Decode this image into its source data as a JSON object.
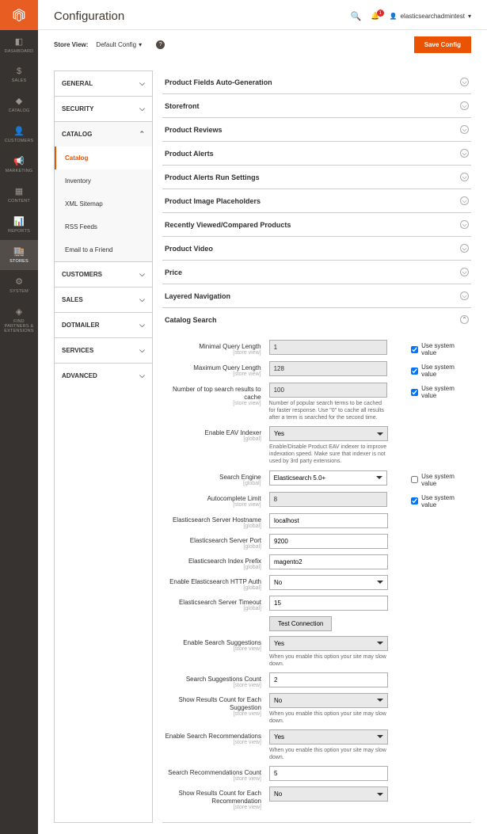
{
  "header": {
    "page_title": "Configuration",
    "notification_count": "1",
    "admin_user": "elasticsearchadmintest"
  },
  "toolbar": {
    "store_view_label": "Store View:",
    "store_view_value": "Default Config",
    "save_label": "Save Config"
  },
  "sidebar": {
    "dashboard": "DASHBOARD",
    "sales": "SALES",
    "catalog": "CATALOG",
    "customers": "CUSTOMERS",
    "marketing": "MARKETING",
    "content": "CONTENT",
    "reports": "REPORTS",
    "stores": "STORES",
    "system": "SYSTEM",
    "extensions": "FIND PARTNERS & EXTENSIONS"
  },
  "config_nav": {
    "groups": [
      {
        "label": "GENERAL",
        "expanded": false
      },
      {
        "label": "SECURITY",
        "expanded": false
      },
      {
        "label": "CATALOG",
        "expanded": true,
        "items": [
          {
            "label": "Catalog",
            "active": true
          },
          {
            "label": "Inventory"
          },
          {
            "label": "XML Sitemap"
          },
          {
            "label": "RSS Feeds"
          },
          {
            "label": "Email to a Friend"
          }
        ]
      },
      {
        "label": "CUSTOMERS",
        "expanded": false
      },
      {
        "label": "SALES",
        "expanded": false
      },
      {
        "label": "DOTMAILER",
        "expanded": false
      },
      {
        "label": "SERVICES",
        "expanded": false
      },
      {
        "label": "ADVANCED",
        "expanded": false
      }
    ]
  },
  "sections": {
    "collapsed": [
      "Product Fields Auto-Generation",
      "Storefront",
      "Product Reviews",
      "Product Alerts",
      "Product Alerts Run Settings",
      "Product Image Placeholders",
      "Recently Viewed/Compared Products",
      "Product Video",
      "Price",
      "Layered Navigation"
    ],
    "catalog_search": {
      "title": "Catalog Search",
      "use_system_value": "Use system value",
      "fields": {
        "min_query": {
          "label": "Minimal Query Length",
          "scope": "[store view]",
          "value": "1"
        },
        "max_query": {
          "label": "Maximum Query Length",
          "scope": "[store view]",
          "value": "128"
        },
        "top_results": {
          "label": "Number of top search results to cache",
          "scope": "[store view]",
          "value": "100",
          "help": "Number of popular search terms to be cached for faster response. Use \"0\" to cache all results after a term is searched for the second time."
        },
        "eav": {
          "label": "Enable EAV Indexer",
          "scope": "[global]",
          "value": "Yes",
          "help": "Enable/Disable Product EAV indexer to improve indexation speed. Make sure that indexer is not used by 3rd party extensions."
        },
        "engine": {
          "label": "Search Engine",
          "scope": "[global]",
          "value": "Elasticsearch 5.0+"
        },
        "autocomplete": {
          "label": "Autocomplete Limit",
          "scope": "[store view]",
          "value": "8"
        },
        "hostname": {
          "label": "Elasticsearch Server Hostname",
          "scope": "[global]",
          "value": "localhost"
        },
        "port": {
          "label": "Elasticsearch Server Port",
          "scope": "[global]",
          "value": "9200"
        },
        "prefix": {
          "label": "Elasticsearch Index Prefix",
          "scope": "[global]",
          "value": "magento2"
        },
        "http_auth": {
          "label": "Enable Elasticsearch HTTP Auth",
          "scope": "[global]",
          "value": "No"
        },
        "timeout": {
          "label": "Elasticsearch Server Timeout",
          "scope": "[global]",
          "value": "15"
        },
        "test_connection": "Test Connection",
        "suggestions": {
          "label": "Enable Search Suggestions",
          "scope": "[store view]",
          "value": "Yes",
          "help": "When you enable this option your site may slow down."
        },
        "suggestions_count": {
          "label": "Search Suggestions Count",
          "scope": "[store view]",
          "value": "2"
        },
        "results_count_sugg": {
          "label": "Show Results Count for Each Suggestion",
          "scope": "[store view]",
          "value": "No",
          "help": "When you enable this option your site may slow down."
        },
        "recommendations": {
          "label": "Enable Search Recommendations",
          "scope": "[store view]",
          "value": "Yes",
          "help": "When you enable this option your site may slow down."
        },
        "recommendations_count": {
          "label": "Search Recommendations Count",
          "scope": "[store view]",
          "value": "5"
        },
        "results_count_rec": {
          "label": "Show Results Count for Each Recommendation",
          "scope": "[store view]",
          "value": "No"
        }
      }
    }
  }
}
